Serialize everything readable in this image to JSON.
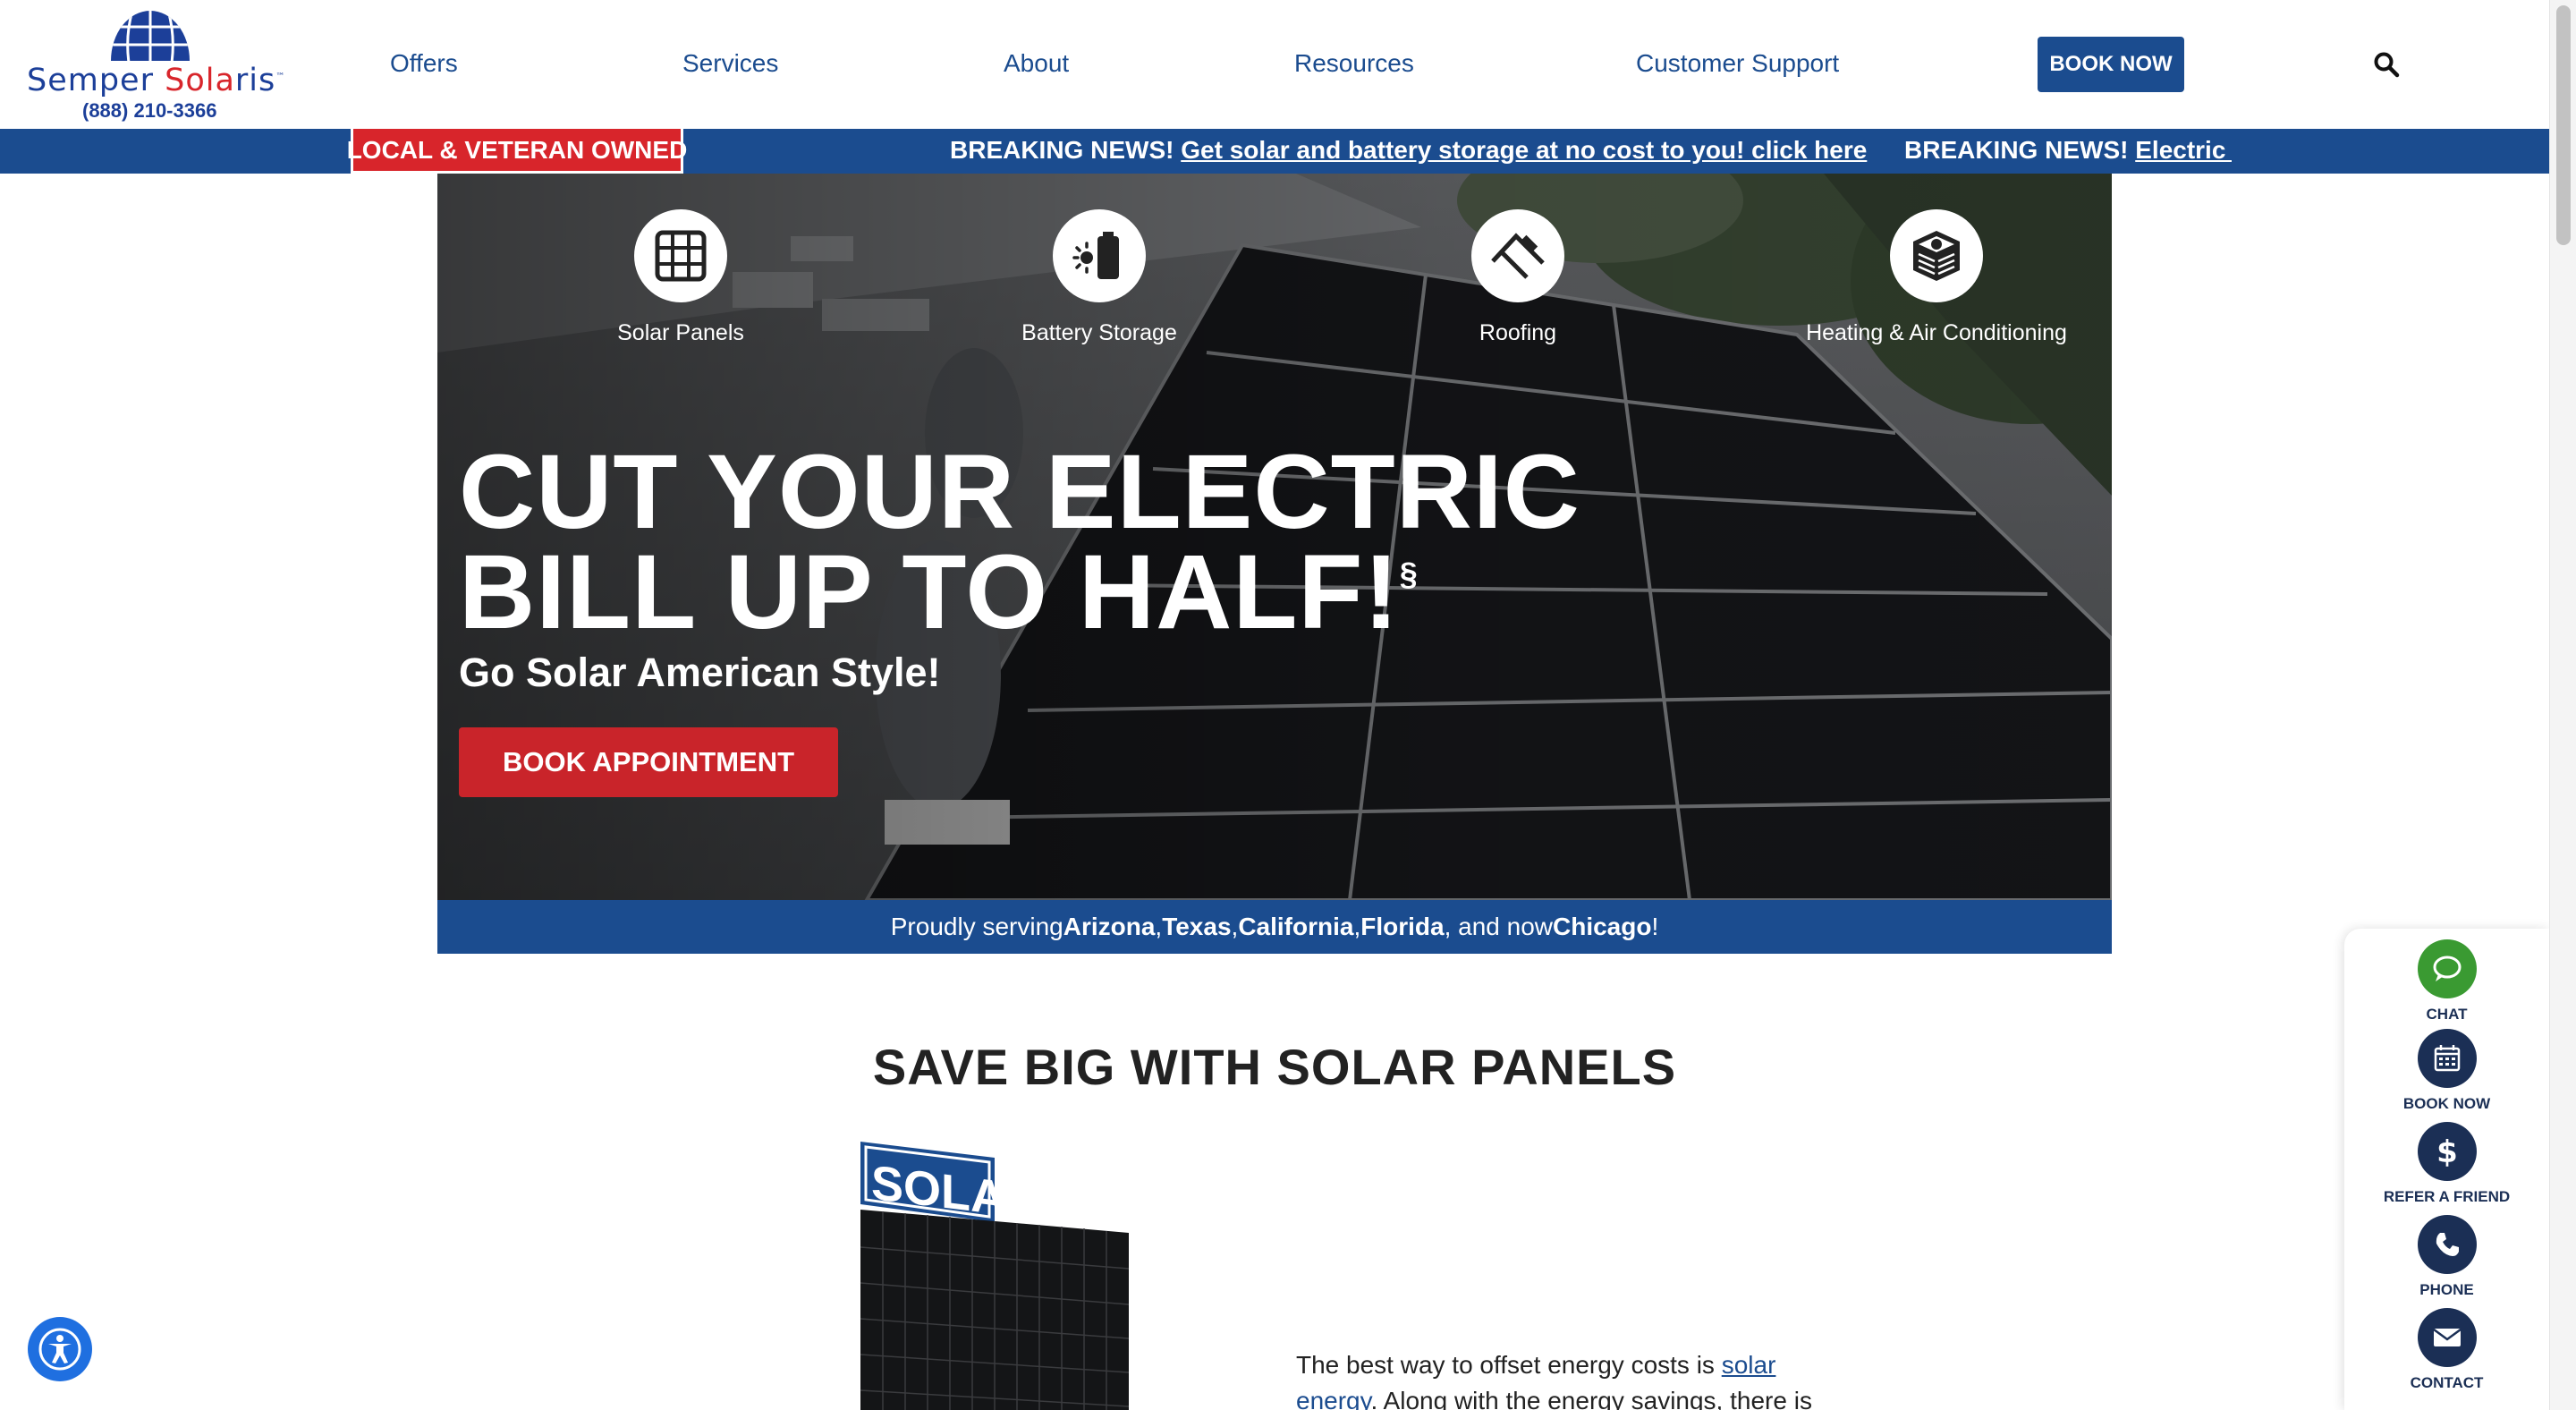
{
  "brand": {
    "name_part1": "Semper ",
    "name_part2": "Sola",
    "name_part3": "ris",
    "tm": "™",
    "phone": "(888) 210-3366",
    "color_primary": "#1b4c8f",
    "color_accent": "#d8252b"
  },
  "nav": {
    "items": [
      "Offers",
      "Services",
      "About",
      "Resources",
      "Customer Support"
    ],
    "book_now": "BOOK NOW",
    "search_icon": "search-icon"
  },
  "banner": {
    "badge": "LOCAL & VETERAN OWNED",
    "news_prefix": "BREAKING NEWS!",
    "news_link": "Get solar and battery storage at no cost to you! click here",
    "news2_prefix": "BREAKING NEWS!",
    "news2_link": "Electric Co"
  },
  "hero": {
    "services": [
      {
        "label": "Solar Panels",
        "icon": "solar-panel-icon"
      },
      {
        "label": "Battery Storage",
        "icon": "battery-icon"
      },
      {
        "label": "Roofing",
        "icon": "roof-icon"
      },
      {
        "label": "Heating & Air Conditioning",
        "icon": "hvac-icon"
      }
    ],
    "headline_line1": "CUT YOUR ELECTRIC",
    "headline_line2": "BILL UP TO HALF!",
    "headline_mark": "§",
    "subhead": "Go Solar American Style!",
    "cta": "BOOK APPOINTMENT"
  },
  "serving": {
    "prefix": "Proudly serving ",
    "s1": "Arizona",
    "sep1": ",",
    "s2": "Texas",
    "sep2": ", ",
    "s3": "California",
    "sep3": ", ",
    "s4": "Florida",
    "sep4": ", and now ",
    "s5": "Chicago",
    "suffix": "!"
  },
  "section": {
    "title": "SAVE BIG WITH SOLAR PANELS",
    "image_sign": "SOLAR",
    "text_before": "The best way to offset energy costs is ",
    "text_link": "solar energy",
    "text_after": ". Along with the energy savings, there is"
  },
  "side_widget": {
    "items": [
      {
        "label": "CHAT",
        "icon": "chat-icon",
        "color": "#3a9a32"
      },
      {
        "label": "BOOK NOW",
        "icon": "calendar-icon",
        "color": "#1b2f55"
      },
      {
        "label": "REFER A FRIEND",
        "icon": "dollar-icon",
        "color": "#1b2f55"
      },
      {
        "label": "PHONE",
        "icon": "phone-icon",
        "color": "#1b2f55"
      },
      {
        "label": "CONTACT",
        "icon": "envelope-icon",
        "color": "#1b2f55"
      }
    ]
  },
  "accessibility": {
    "icon": "accessibility-icon"
  }
}
